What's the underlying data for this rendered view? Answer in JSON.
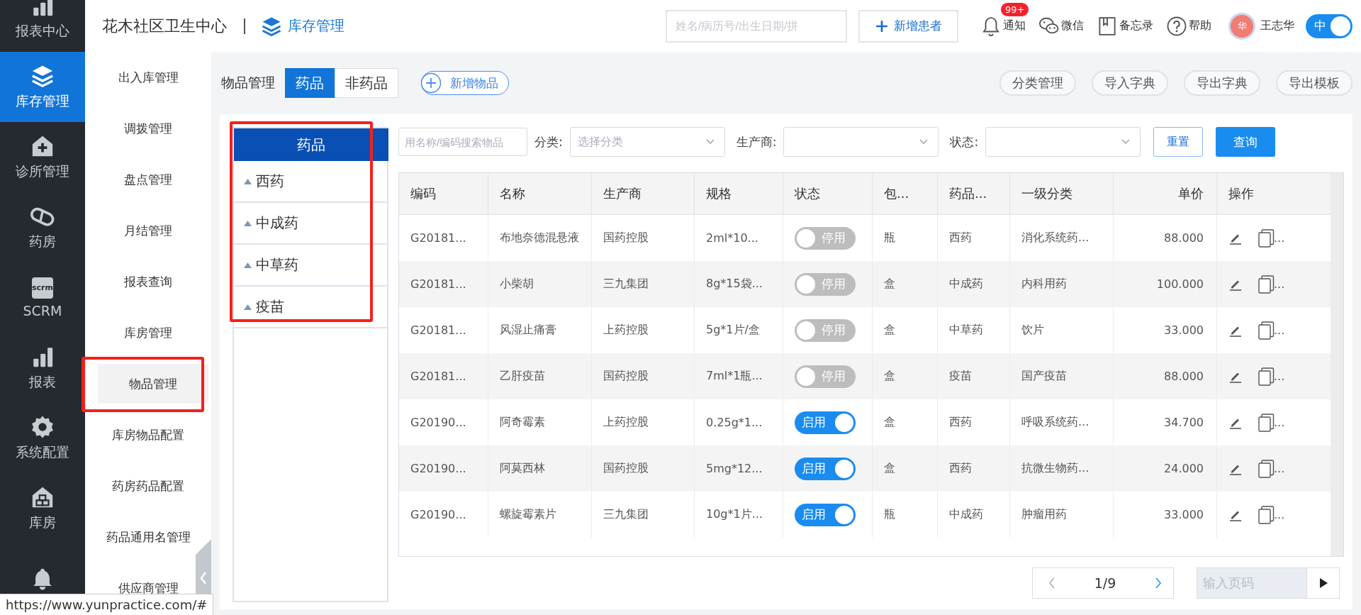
{
  "nav_rail": {
    "items": [
      {
        "kind": "bars",
        "label": "报表中心",
        "selected": false
      },
      {
        "kind": "layers",
        "label": "库存管理",
        "selected": true
      },
      {
        "kind": "clinic",
        "label": "诊所管理",
        "selected": false
      },
      {
        "kind": "pill",
        "label": "药房",
        "selected": false
      },
      {
        "kind": "scrm",
        "label": "SCRM",
        "selected": false,
        "icon_text": "scrm"
      },
      {
        "kind": "bars",
        "label": "报表",
        "selected": false
      },
      {
        "kind": "gear",
        "label": "系统配置",
        "selected": false
      },
      {
        "kind": "house",
        "label": "库房",
        "selected": false
      },
      {
        "kind": "bell",
        "selected": false
      }
    ]
  },
  "header": {
    "org_name": "花木社区卫生中心",
    "module": "库存管理",
    "search": {
      "placeholder": "姓名/病历号/出生日期/拼"
    },
    "new_patient_button": "新增患者",
    "tools": [
      {
        "kind": "bell",
        "label": "通知",
        "badge": "99+"
      },
      {
        "kind": "chat",
        "label": "微信"
      },
      {
        "kind": "book",
        "label": "备忘录"
      },
      {
        "kind": "help",
        "label": "帮助"
      }
    ],
    "user": {
      "avatar_text": "华",
      "name": "王志华"
    },
    "lang_switch": {
      "label": "中",
      "on": true
    }
  },
  "submenu": {
    "items": [
      {
        "label": "出入库管理",
        "selected": false,
        "highlighted": false
      },
      {
        "label": "调拨管理",
        "selected": false,
        "highlighted": false
      },
      {
        "label": "盘点管理",
        "selected": false,
        "highlighted": false
      },
      {
        "label": "月结管理",
        "selected": false,
        "highlighted": false
      },
      {
        "label": "报表查询",
        "selected": false,
        "highlighted": false
      },
      {
        "label": "库房管理",
        "selected": false,
        "highlighted": false
      },
      {
        "label": "物品管理",
        "selected": true,
        "highlighted": true
      },
      {
        "label": "库房物品配置",
        "selected": false,
        "highlighted": false
      },
      {
        "label": "药房药品配置",
        "selected": false,
        "highlighted": false
      },
      {
        "label": "药品通用名管理",
        "selected": false,
        "highlighted": false
      },
      {
        "label": "供应商管理",
        "selected": false,
        "highlighted": false
      }
    ]
  },
  "page": {
    "title": "物品管理",
    "tabs": [
      {
        "label": "药品",
        "selected": true
      },
      {
        "label": "非药品",
        "selected": false
      }
    ],
    "add_button": "新增物品",
    "actions": [
      "分类管理",
      "导入字典",
      "导出字典",
      "导出模板"
    ]
  },
  "category_tree": {
    "header": "药品",
    "highlighted": true,
    "items": [
      {
        "label": "西药"
      },
      {
        "label": "中成药"
      },
      {
        "label": "中草药"
      },
      {
        "label": "疫苗"
      }
    ]
  },
  "filters": {
    "search": {
      "placeholder": "用名称/编码搜索物品"
    },
    "selects": [
      {
        "label": "分类:",
        "placeholder": "选择分类"
      },
      {
        "label": "生产商:"
      },
      {
        "label": "状态:"
      }
    ],
    "reset_button": "重置",
    "query_button": "查询"
  },
  "table": {
    "columns": [
      "编码",
      "名称",
      "生产商",
      "规格",
      "状态",
      "包...",
      "药品...",
      "一级分类",
      "单价",
      "操作"
    ],
    "rows": [
      {
        "code": "G20181...",
        "name": "布地奈德混悬液",
        "maker": "国药控股",
        "spec": "2ml*10...",
        "status": {
          "label": "停用",
          "on": false
        },
        "pack": "瓶",
        "type": "西药",
        "category": "消化系统药...",
        "price": "88.000",
        "more": "..."
      },
      {
        "code": "G20181...",
        "name": "小柴胡",
        "maker": "三九集团",
        "spec": "8g*15袋...",
        "status": {
          "label": "停用",
          "on": false
        },
        "pack": "盒",
        "type": "中成药",
        "category": "内科用药",
        "price": "100.000",
        "more": "..."
      },
      {
        "code": "G20181...",
        "name": "风湿止痛膏",
        "maker": "上药控股",
        "spec": "5g*1片/盒",
        "status": {
          "label": "停用",
          "on": false
        },
        "pack": "盒",
        "type": "中草药",
        "category": "饮片",
        "price": "33.000",
        "more": "..."
      },
      {
        "code": "G20181...",
        "name": "乙肝疫苗",
        "maker": "国药控股",
        "spec": "7ml*1瓶...",
        "status": {
          "label": "停用",
          "on": false
        },
        "pack": "盒",
        "type": "疫苗",
        "category": "国产疫苗",
        "price": "88.000",
        "more": "..."
      },
      {
        "code": "G20190...",
        "name": "阿奇霉素",
        "maker": "上药控股",
        "spec": "0.25g*1...",
        "status": {
          "label": "启用",
          "on": true
        },
        "pack": "盒",
        "type": "西药",
        "category": "呼吸系统药...",
        "price": "34.700",
        "more": "..."
      },
      {
        "code": "G20190...",
        "name": "阿莫西林",
        "maker": "国药控股",
        "spec": "5mg*12...",
        "status": {
          "label": "启用",
          "on": true
        },
        "pack": "盒",
        "type": "西药",
        "category": "抗微生物药...",
        "price": "24.000",
        "more": "..."
      },
      {
        "code": "G20190...",
        "name": "螺旋霉素片",
        "maker": "三九集团",
        "spec": "10g*1片...",
        "status": {
          "label": "启用",
          "on": true
        },
        "pack": "瓶",
        "type": "中成药",
        "category": "肿瘤用药",
        "price": "33.000",
        "more": "..."
      }
    ]
  },
  "pagination": {
    "page": "1/9",
    "jump_placeholder": "输入页码"
  },
  "status_url": "https://www.yunpractice.com/#"
}
